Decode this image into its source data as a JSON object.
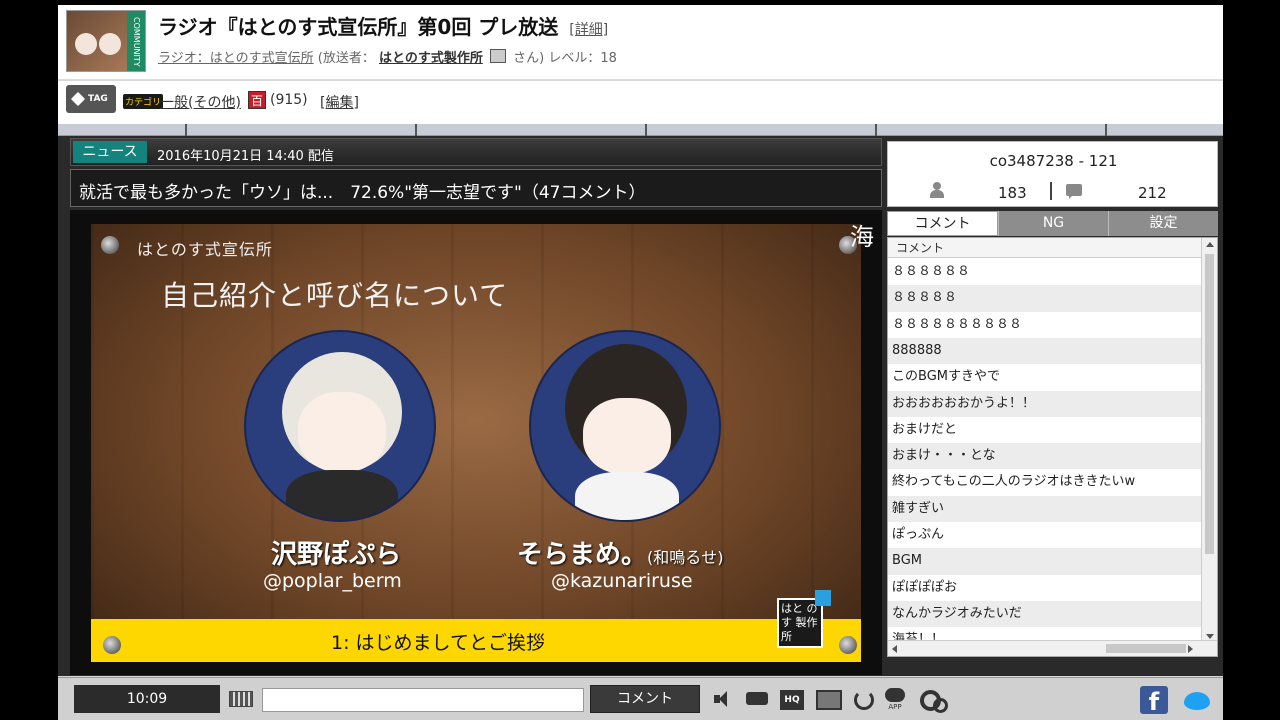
{
  "header": {
    "thumb_label": "COMMUNITY",
    "title": "ラジオ『はとのす式宣伝所』第0回 プレ放送",
    "detail_link": "[詳細]",
    "community_prefix": "ラジオ：はとのす式宣伝所",
    "broadcaster_prefix": "(放送者：",
    "broadcaster_name": "はとのす式製作所",
    "broadcaster_suffix": "さん) レベル：18"
  },
  "tags": {
    "tag_label": "TAG",
    "category_badge": "カテゴリ",
    "category_link": "一般(その他)",
    "hyaku_badge": "百",
    "hyaku_count": "(915)",
    "edit_link": "[編集]"
  },
  "news": {
    "label": "ニュース",
    "date": "2016年10月21日 14:40 配信",
    "headline": "就活で最も多かった「ウソ」は...　72.6%\"第一志望です\"（47コメント）"
  },
  "slide": {
    "program_name": "はとのす式宣伝所",
    "title": "自己紹介と呼び名について",
    "host1_name": "沢野ぽぷら",
    "host1_handle": "@poplar_berm",
    "host2_name": "そらまめ。",
    "host2_reading": "(和鳴るせ)",
    "host2_handle": "@kazunariruse",
    "corner_text": "1: はじめましてとご挨拶",
    "logo_text": "はと の す 製作所",
    "overlay_char": "海"
  },
  "panel": {
    "community_id": "co3487238 - 121",
    "viewers": "183",
    "comments_count": "212",
    "tabs": [
      "コメント",
      "NG",
      "設定"
    ],
    "comment_header": "コメント",
    "comments": [
      "８８８８８８",
      "８８８８８",
      "８８８８８８８８８８",
      "888888",
      "このBGMすきやで",
      "おおおおおおかうよ！！",
      "おまけだと",
      "おまけ・・・とな",
      "終わってもこの二人のラジオはききたいw",
      "雑すぎい",
      "ぽっぷん",
      "BGM",
      "ぽぽぽぽお",
      "なんかラジオみたいだ",
      "海苔！！"
    ]
  },
  "bottom": {
    "time": "10:09",
    "comment_input_value": "",
    "comment_button": "コメント",
    "hq_label": "HQ",
    "app_label": "APP",
    "facebook_glyph": "f"
  }
}
